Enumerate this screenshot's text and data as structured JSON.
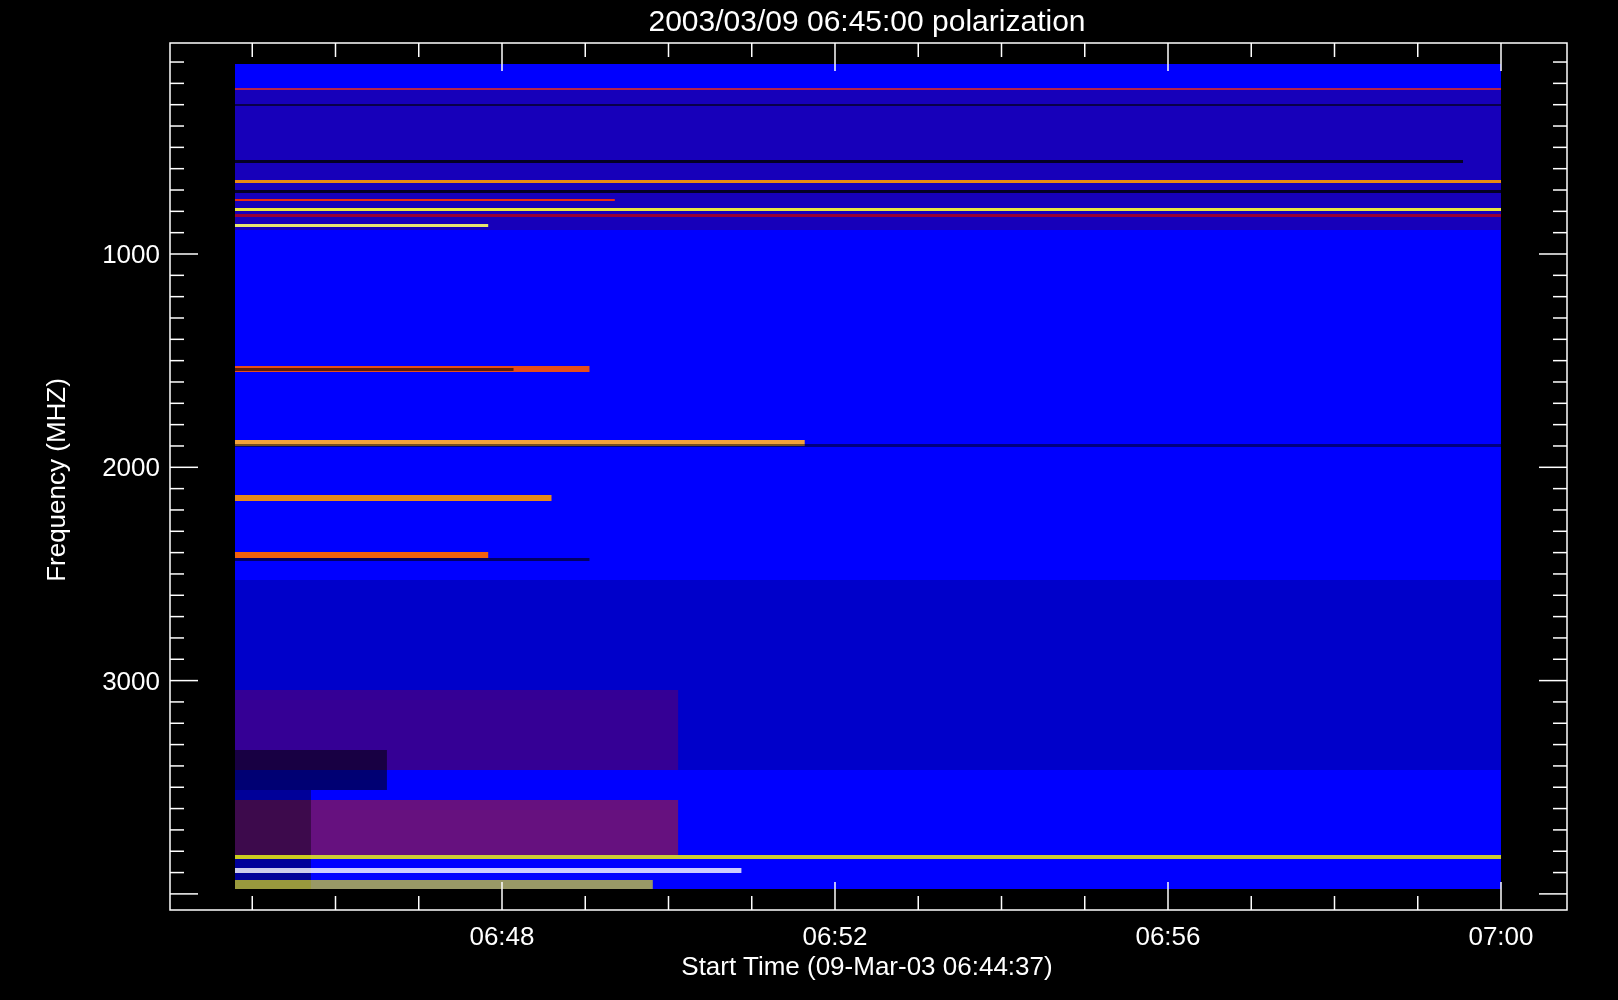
{
  "chart": {
    "title": "2003/03/09 06:45:00 polarization",
    "y_axis": {
      "label": "Frequency (MHZ)",
      "ticks": [
        "1000",
        "2000",
        "3000"
      ]
    },
    "x_axis": {
      "label": "Start Time (09-Mar-03 06:44:37)",
      "ticks": [
        "06:48",
        "06:52",
        "06:56",
        "07:00"
      ]
    }
  }
}
